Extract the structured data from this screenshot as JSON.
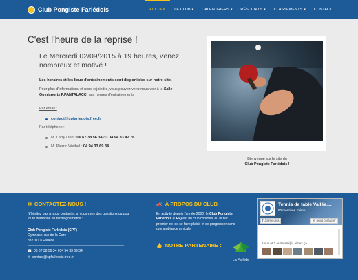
{
  "brand": {
    "name": "Club Pongiste Farlédois",
    "logo": "club-logo-icon"
  },
  "nav": {
    "items": [
      {
        "label": "ACCUEIL",
        "active": true,
        "dropdown": false
      },
      {
        "label": "LE CLUB",
        "active": false,
        "dropdown": true
      },
      {
        "label": "CALENDRIERS",
        "active": false,
        "dropdown": true
      },
      {
        "label": "RÉSULTATS",
        "active": false,
        "dropdown": true
      },
      {
        "label": "CLASSEMENTS",
        "active": false,
        "dropdown": true
      },
      {
        "label": "CONTACT",
        "active": false,
        "dropdown": false
      }
    ],
    "caret": "▾"
  },
  "main": {
    "title": "C'est l'heure de la reprise !",
    "subtitle": "Le Mercredi 02/09/2015 à 19 heures, venez nombreux et motivé !",
    "highlight": "Les horaires et les lieux d'entrainements sont disponibles sur notre site.",
    "info_pre": "Pour plus d'informations et nous rejoindre, vous pouvez venir nous voir à la",
    "info_place": "Salle Omnisports F.PANTALACCI",
    "info_post": "aux heures d'entrainements !",
    "email_label": "Par email :",
    "email": "contact@cpfarledois.free.fr",
    "phone_label": "Par téléphone :",
    "contacts": [
      {
        "name": "M. Larry Lion :",
        "phone1": "06 67 38 56 34",
        "sep": "ou",
        "phone2": "04 94 33 42 76"
      },
      {
        "name": "M. Pierric Weibel :",
        "phone1": "04 94 33 69 34"
      }
    ],
    "photo_caption_1": "Bienvenue sur le site du",
    "photo_caption_2": "Club Pongiste Farlédois !"
  },
  "footer": {
    "contact_title": "CONTACTEZ-NOUS !",
    "contact_intro": "N'hésitez pas à nous contacter, si vous avez des questions ou pour toute demande de renseignements :",
    "club_name": "Club Pongiste Farlédois (CPF)",
    "address_1": "Gymnase, rue de la Gare",
    "address_2": "83210 La Farlède",
    "phones": "06 67 38 56 34 | 04 94 33 69 34",
    "email": "contact@cpfarledois.free.fr",
    "about_title": "À PROPOS DU CLUB :",
    "about_pre": "En activité depuis l'année 2000, le",
    "about_club": "Club Pongiste Farlédois (CPF)",
    "about_post": "est un club convivial ou le but premier est de se faire plaisir et de progresser dans une ambiance amicale.",
    "partner_title": "NOTRE PARTENAIRE :",
    "partner_name": "La Farlède",
    "facebook": {
      "page_name": "Tennis de table Vallée....",
      "likes": "90 mentions J'aime",
      "like_button": "J'aime déjà",
      "contact_button": "Nous contacter",
      "friends_text": "Vous et 1 autre ami(e) aimez ça"
    }
  },
  "colors": {
    "nav_bg": "#1d5b98",
    "accent": "#f4c21a",
    "footer_bg": "#1e5c99",
    "page_bg": "#ebebeb"
  }
}
